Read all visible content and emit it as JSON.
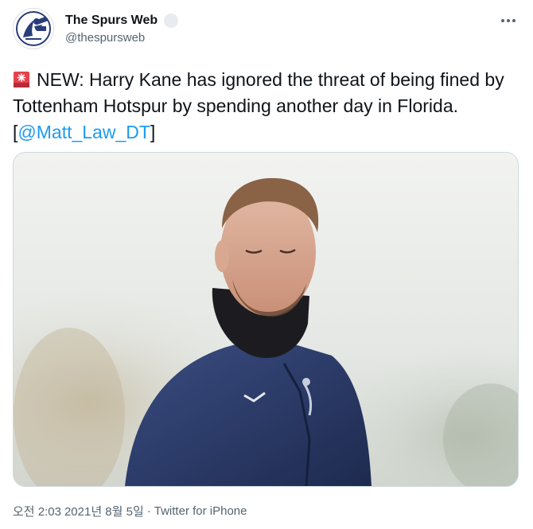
{
  "author": {
    "display_name": "The Spurs Web",
    "handle": "@thespursweb",
    "avatar_icon": "spurs-web-logo"
  },
  "tweet": {
    "emoji_icon": "rotating-light-icon",
    "text_before_mention": "NEW: Harry Kane has ignored the threat of being fined by Tottenham Hotspur by spending another day in Florida. [",
    "mention": "@Matt_Law_DT",
    "text_after_mention": "]"
  },
  "media": {
    "description_icon": "photo-player-in-training-jacket"
  },
  "meta": {
    "time": "오전 2:03",
    "separator": "·",
    "date": "2021년 8월 5일",
    "source": "Twitter for iPhone"
  },
  "colors": {
    "link": "#1d9bf0",
    "secondary_text": "#536471",
    "border": "#cfd9de",
    "jacket": "#26355e"
  }
}
